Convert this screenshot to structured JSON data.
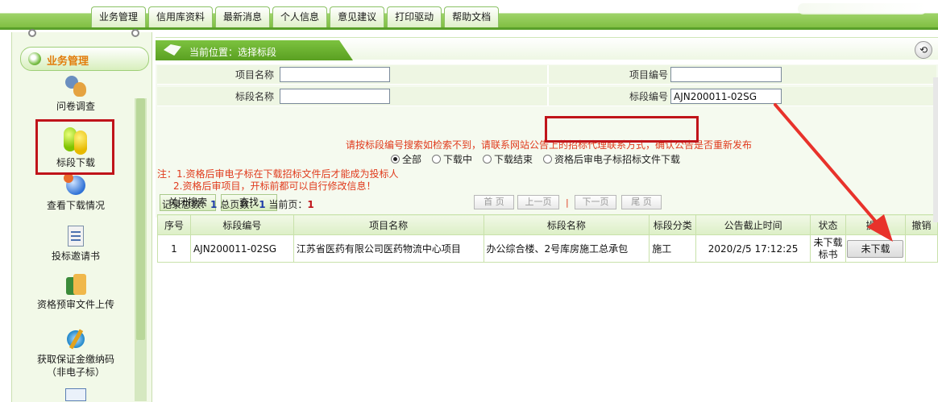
{
  "top_nav": {
    "tabs": [
      "业务管理",
      "信用库资料",
      "最新消息",
      "个人信息",
      "意见建议",
      "打印驱动",
      "帮助文档"
    ]
  },
  "sidebar": {
    "header": "业务管理",
    "items": [
      {
        "label": "问卷调查",
        "icon": "people-icon"
      },
      {
        "label": "标段下载",
        "icon": "download-icon"
      },
      {
        "label": "查看下载情况",
        "icon": "globe-icon"
      },
      {
        "label": "投标邀请书",
        "icon": "document-icon"
      },
      {
        "label": "资格预审文件上传",
        "icon": "upload-icon"
      },
      {
        "label": "获取保证金缴纳码（非电子标）",
        "icon": "tools-icon"
      }
    ]
  },
  "breadcrumb": {
    "text": "当前位置：选择标段"
  },
  "search_form": {
    "project_name_label": "项目名称",
    "project_name_value": "",
    "project_no_label": "项目编号",
    "project_no_value": "",
    "section_name_label": "标段名称",
    "section_name_value": "",
    "section_no_label": "标段编号",
    "section_no_value": "AJN200011-02SG",
    "warning": "请按标段编号搜索如检索不到，请联系网站公告上的招标代理联系方式，确认公告是否重新发布",
    "filters": [
      "全部",
      "下载中",
      "下载结束",
      "资格后审电子标招标文件下载"
    ],
    "selected_filter": "全部",
    "note_line1": "注：1.资格后审电子标在下载招标文件后才能成为投标人",
    "note_line2": "2.资格后审项目，开标前都可以自行修改信息！",
    "close_search_label": "关闭搜索",
    "search_label": "查找"
  },
  "pager": {
    "total_records_label": "记录总数：",
    "total_records": "1",
    "total_pages_label": "总页数：",
    "total_pages": "1",
    "current_page_label": "当前页：",
    "current_page": "1",
    "first": "首  页",
    "prev": "上一页",
    "separator": "|",
    "next": "下一页",
    "last": "尾  页"
  },
  "table": {
    "columns": [
      "序号",
      "标段编号",
      "项目名称",
      "标段名称",
      "标段分类",
      "公告截止时间",
      "状态",
      "操作",
      "撤销"
    ],
    "rows": [
      {
        "index": "1",
        "section_no": "AJN200011-02SG",
        "project_name": "江苏省医药有限公司医药物流中心项目",
        "section_name": "办公综合楼、2号库房施工总承包",
        "category": "施工",
        "deadline": "2020/2/5 17:12:25",
        "status": "未下载标书",
        "action": "未下载",
        "revoke": ""
      }
    ]
  },
  "colors": {
    "accent_green": "#5aa021",
    "warning_red": "#e03a1c",
    "highlight_red": "#c0141a",
    "sidebar_header_text": "#e27d0c",
    "pager_number": "#1f3ca8"
  }
}
